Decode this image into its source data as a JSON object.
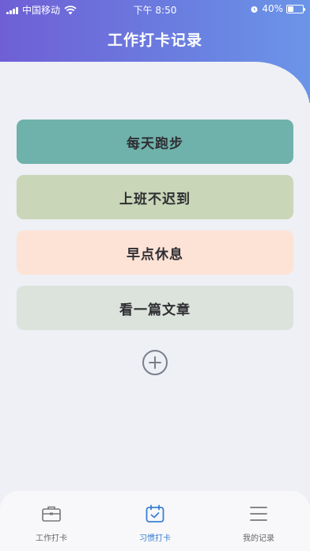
{
  "status_bar": {
    "carrier": "中国移动",
    "time": "下午 8:50",
    "battery": "40%",
    "battery_level": 0.4
  },
  "header": {
    "title": "工作打卡记录"
  },
  "habits": [
    {
      "label": "每天跑步",
      "color": "#6fb1ab"
    },
    {
      "label": "上班不迟到",
      "color": "#c9d6b8"
    },
    {
      "label": "早点休息",
      "color": "#fde3d6"
    },
    {
      "label": "看一篇文章",
      "color": "#dce2dc"
    }
  ],
  "add_button": {
    "icon": "plus-circle-icon"
  },
  "tabbar": {
    "tabs": [
      {
        "label": "工作打卡",
        "icon": "briefcase-icon",
        "active": false
      },
      {
        "label": "习惯打卡",
        "icon": "calendar-check-icon",
        "active": true
      },
      {
        "label": "我的记录",
        "icon": "menu-icon",
        "active": false
      }
    ],
    "active_color": "#3b7fd4"
  }
}
